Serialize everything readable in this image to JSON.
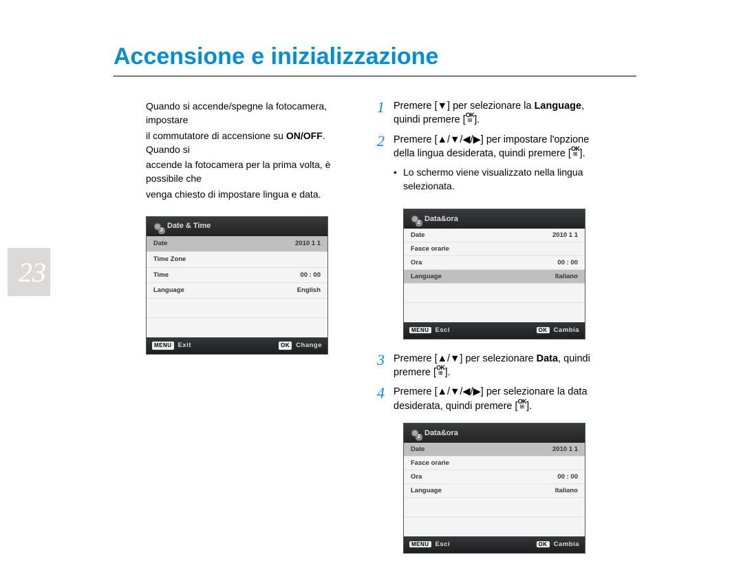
{
  "page": {
    "title": "Accensione e inizializzazione",
    "number": "23"
  },
  "left": {
    "para_line1": "Quando si accende/spegne la fotocamera, impostare",
    "para_line2a": "il commutatore di accensione su ",
    "para_line2b": "ON/OFF",
    "para_line2c": ". Quando si",
    "para_line3": "accende la fotocamera per la prima volta, è possibile che",
    "para_line4": "venga chiesto di impostare lingua e data."
  },
  "screenshot1": {
    "title": "Date & Time",
    "rows": [
      {
        "label": "Date",
        "value": "2010   1   1",
        "highlight": true
      },
      {
        "label": "Time Zone",
        "value": ""
      },
      {
        "label": "Time",
        "value": "00 : 00"
      },
      {
        "label": "Language",
        "value": "English"
      }
    ],
    "footer_left_key": "MENU",
    "footer_left_label": "Exit",
    "footer_right_key": "OK",
    "footer_right_label": "Change"
  },
  "steps": {
    "s1_pre": "Premere [",
    "s1_mid": "] per selezionare la ",
    "s1_bold": "Language",
    "s1_after": ",",
    "s1_line2_pre": "quindi premere [",
    "s1_line2_post": "].",
    "s2_pre": "Premere [",
    "s2_mid": "] per impostare l'opzione",
    "s2_line2_pre": "della lingua desiderata, quindi premere [",
    "s2_line2_post": "].",
    "s2_bullet_l1": "Lo schermo viene visualizzato nella lingua",
    "s2_bullet_l2": "selezionata.",
    "s3_pre": "Premere [",
    "s3_mid": "] per selezionare ",
    "s3_bold": "Data",
    "s3_after": ", quindi",
    "s3_line2_pre": "premere [",
    "s3_line2_post": "].",
    "s4_pre": "Premere [",
    "s4_mid": "] per selezionare la data",
    "s4_line2_pre": "desiderata, quindi premere [",
    "s4_line2_post": "]."
  },
  "screenshot2": {
    "title": "Data&ora",
    "rows": [
      {
        "label": "Date",
        "value": "2010   1   1"
      },
      {
        "label": "Fasce orarie",
        "value": ""
      },
      {
        "label": "Ora",
        "value": "00 : 00"
      },
      {
        "label": "Language",
        "value": "Italiano",
        "highlight": true
      }
    ],
    "footer_left_key": "MENU",
    "footer_left_label": "Esci",
    "footer_right_key": "OK",
    "footer_right_label": "Cambia"
  },
  "screenshot3": {
    "title": "Data&ora",
    "rows": [
      {
        "label": "Date",
        "value": "2010   1   1",
        "highlight": true
      },
      {
        "label": "Fasce orarie",
        "value": ""
      },
      {
        "label": "Ora",
        "value": "00 : 00"
      },
      {
        "label": "Language",
        "value": "Italiano"
      }
    ],
    "footer_left_key": "MENU",
    "footer_left_label": "Esci",
    "footer_right_key": "OK",
    "footer_right_label": "Cambia"
  },
  "symbols": {
    "down_arrow": "▼",
    "arrows4": "▲/▼/◀/▶",
    "arrows2": "▲/▼"
  }
}
